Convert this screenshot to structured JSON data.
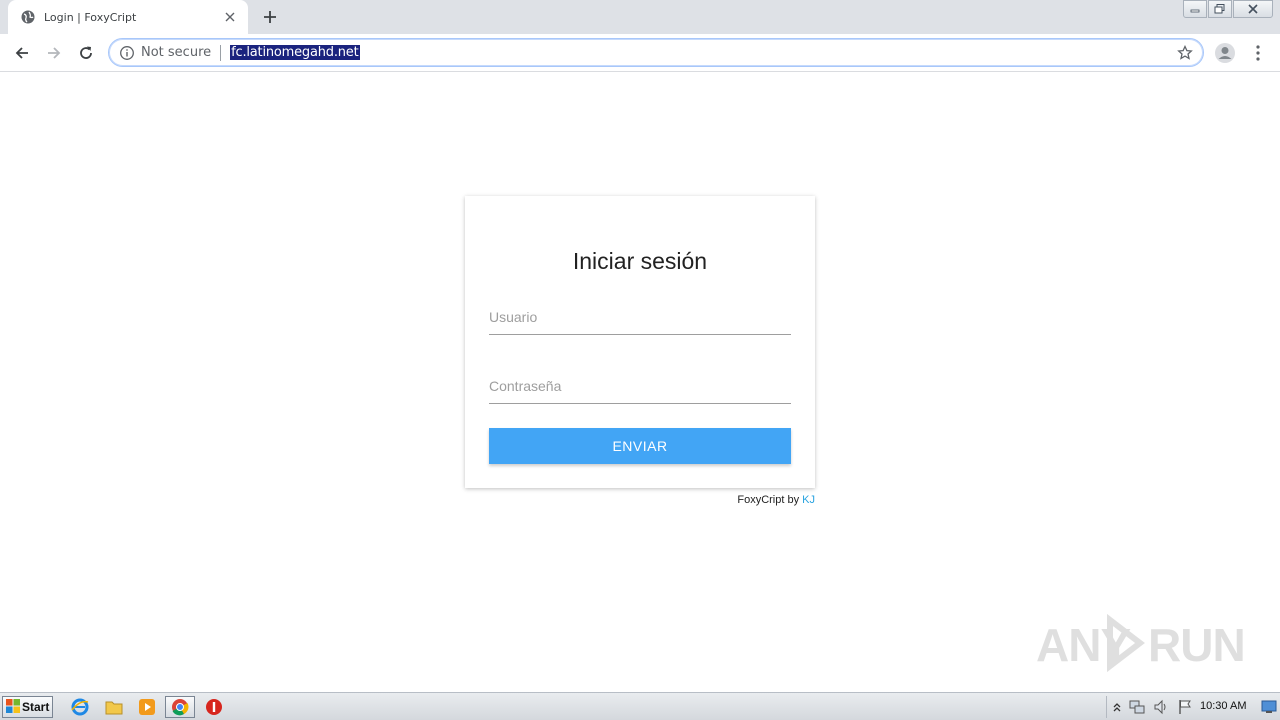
{
  "browser": {
    "tab_title": "Login | FoxyCript",
    "security_label": "Not secure",
    "url": "fc.latinomegahd.net"
  },
  "login": {
    "title": "Iniciar sesión",
    "username_placeholder": "Usuario",
    "password_placeholder": "Contraseña",
    "submit_label": "ENVIAR"
  },
  "footer": {
    "credit_prefix": "FoxyCript by ",
    "credit_author": "KJ"
  },
  "watermark": {
    "text_left": "ANY",
    "text_right": "RUN"
  },
  "taskbar": {
    "start_label": "Start",
    "clock": "10:30 AM"
  },
  "colors": {
    "submit_button": "#42a5f5",
    "author_link": "#29a3e0",
    "url_highlight": "#1a237e"
  },
  "icons": {
    "tab": "globe-icon",
    "tab_close": "close-icon",
    "new_tab": "plus-icon",
    "back": "arrow-left-icon",
    "forward": "arrow-right-icon",
    "reload": "reload-icon",
    "site_info": "info-icon",
    "bookmark": "star-icon",
    "profile": "avatar-icon",
    "menu": "kebab-menu-icon"
  }
}
